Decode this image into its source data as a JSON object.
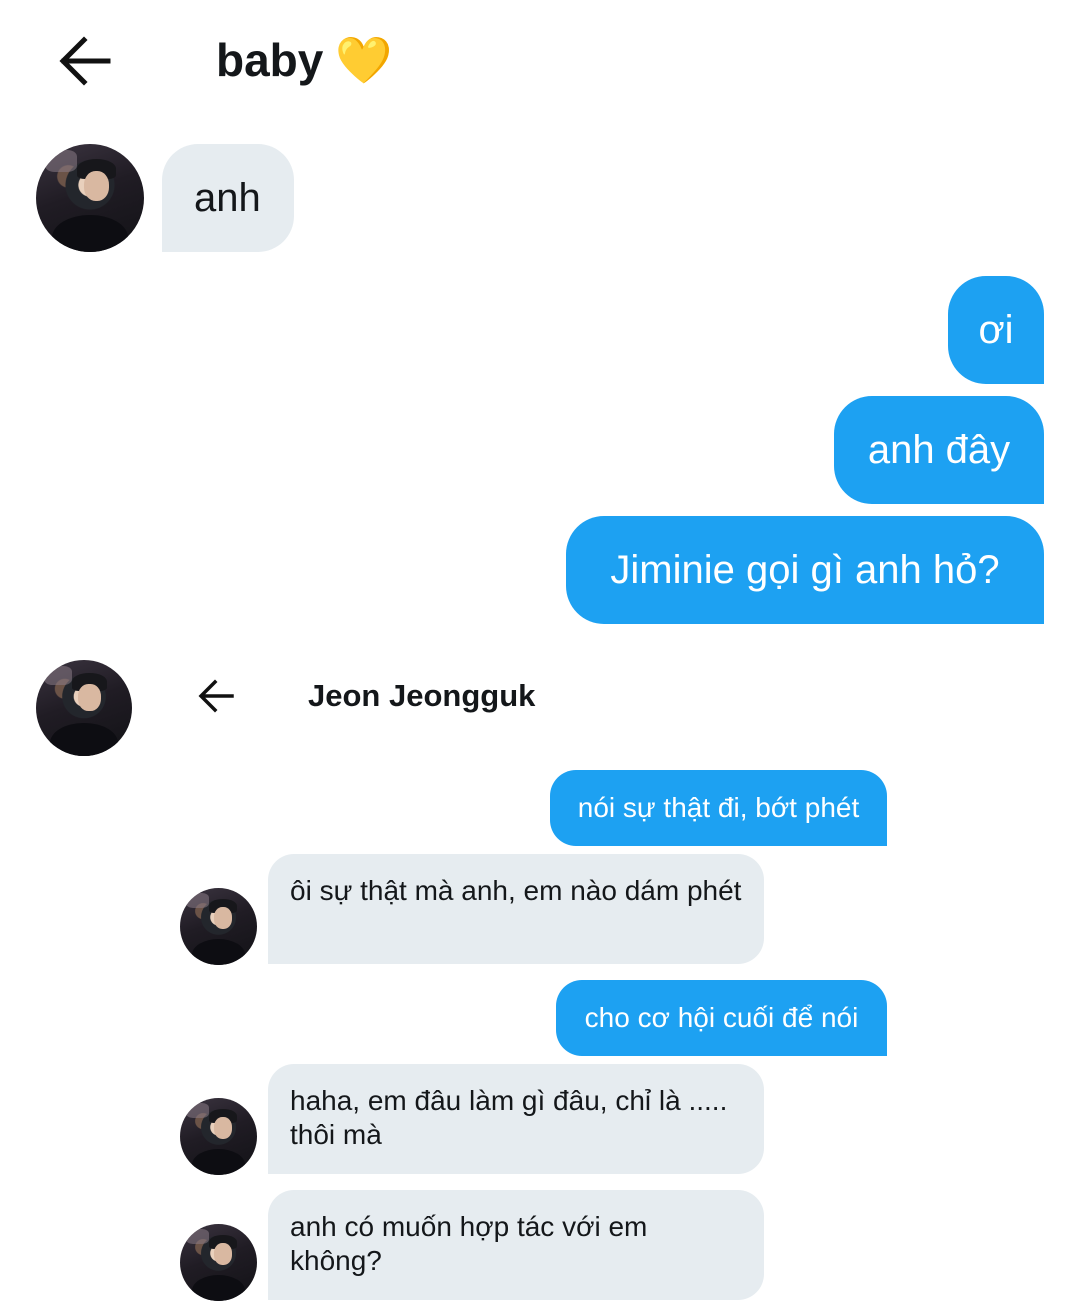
{
  "header": {
    "title": "baby",
    "title_emoji": "💛",
    "back_icon": "arrow-left-icon"
  },
  "messages": [
    {
      "side": "received",
      "text": "anh"
    },
    {
      "side": "sent",
      "text": "ơi"
    },
    {
      "side": "sent",
      "text": "anh đây"
    },
    {
      "side": "sent",
      "text": "Jiminie gọi gì anh hỏ?"
    }
  ],
  "inner_chat": {
    "title": "Jeon Jeongguk",
    "back_icon": "arrow-left-icon",
    "messages": [
      {
        "side": "sent",
        "text": "nói sự thật đi, bớt phét"
      },
      {
        "side": "received",
        "text": "ôi sự thật mà anh, em nào dám phét"
      },
      {
        "side": "sent",
        "text": "cho cơ hội cuối để nói"
      },
      {
        "side": "received",
        "text": "haha, em đâu làm gì đâu, chỉ là ..... thôi mà"
      },
      {
        "side": "received",
        "text": "anh có muốn hợp tác với em không?"
      }
    ]
  },
  "colors": {
    "sent_bubble": "#1da1f2",
    "received_bubble": "#e6ecf0",
    "background": "#ffffff"
  }
}
